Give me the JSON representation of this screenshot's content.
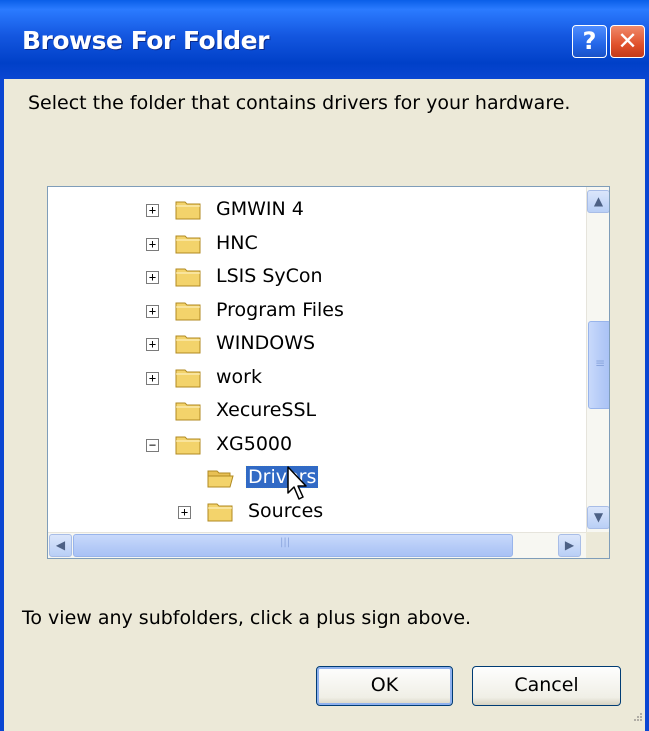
{
  "window": {
    "title": "Browse For Folder",
    "help_icon": "?",
    "close_icon": "✕"
  },
  "instruction": "Select the folder that contains drivers for your hardware.",
  "tree": {
    "items": [
      {
        "label": "GMWIN 4",
        "expander": "+",
        "level": 0
      },
      {
        "label": "HNC",
        "expander": "+",
        "level": 0
      },
      {
        "label": "LSIS SyCon",
        "expander": "+",
        "level": 0
      },
      {
        "label": "Program Files",
        "expander": "+",
        "level": 0
      },
      {
        "label": "WINDOWS",
        "expander": "+",
        "level": 0
      },
      {
        "label": "work",
        "expander": "+",
        "level": 0
      },
      {
        "label": "XecureSSL",
        "expander": "",
        "level": 0
      },
      {
        "label": "XG5000",
        "expander": "−",
        "level": 0
      },
      {
        "label": "Drivers",
        "expander": "",
        "level": 1,
        "selected": true
      },
      {
        "label": "Sources",
        "expander": "+",
        "level": 1
      }
    ],
    "scroll_up": "▲",
    "scroll_down": "▼",
    "scroll_left": "◀",
    "scroll_right": "▶",
    "thumb_grip": "≡",
    "thumb_grip_h": "|||"
  },
  "hint": "To view any subfolders, click a plus sign above.",
  "buttons": {
    "ok": "OK",
    "cancel": "Cancel"
  },
  "colors": {
    "selection": "#316ac5",
    "folder": "#f3d36b"
  }
}
